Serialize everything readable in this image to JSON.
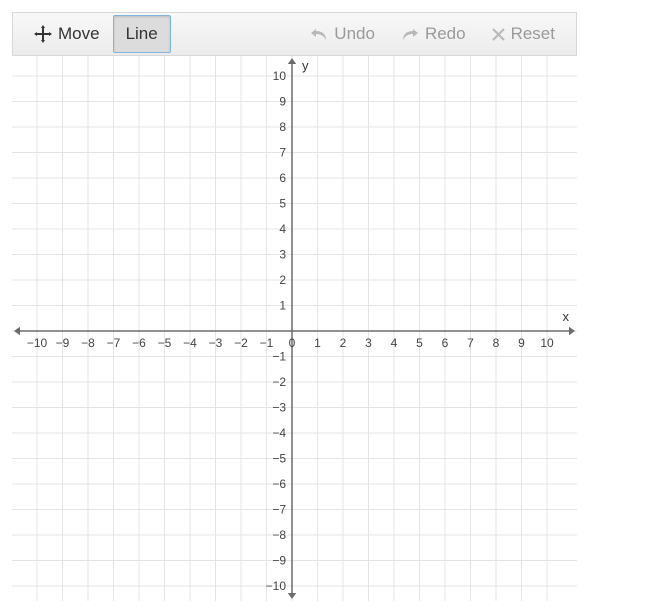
{
  "toolbar": {
    "move_label": "Move",
    "line_label": "Line",
    "undo_label": "Undo",
    "redo_label": "Redo",
    "reset_label": "Reset",
    "selected": "line"
  },
  "chart_data": {
    "type": "scatter",
    "title": "",
    "xlabel": "x",
    "ylabel": "y",
    "xlim": [
      -10,
      10
    ],
    "ylim": [
      -10,
      10
    ],
    "x_ticks": [
      -10,
      -9,
      -8,
      -7,
      -6,
      -5,
      -4,
      -3,
      -2,
      -1,
      0,
      1,
      2,
      3,
      4,
      5,
      6,
      7,
      8,
      9,
      10
    ],
    "y_ticks": [
      -10,
      -9,
      -8,
      -7,
      -6,
      -5,
      -4,
      -3,
      -2,
      -1,
      1,
      2,
      3,
      4,
      5,
      6,
      7,
      8,
      9,
      10
    ],
    "grid": true,
    "series": []
  }
}
